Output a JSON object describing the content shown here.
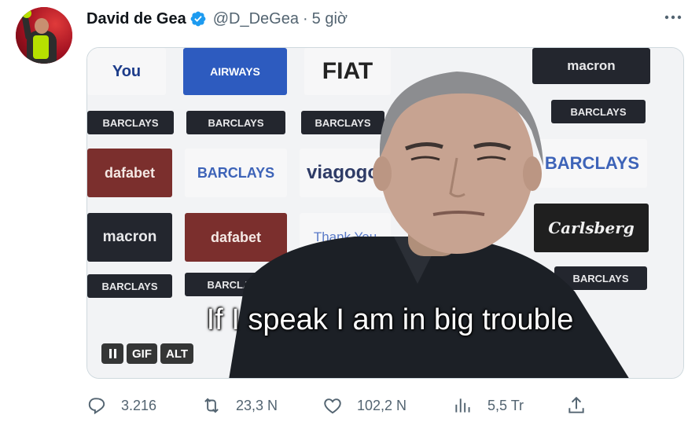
{
  "author": {
    "display_name": "David de Gea",
    "handle": "@D_DeGea",
    "separator": "·",
    "time": "5 giờ",
    "verified": true
  },
  "media": {
    "subtitle": "If I speak I am in big trouble",
    "badges": {
      "gif": "GIF",
      "alt": "ALT"
    },
    "sponsors": [
      "You",
      "AIRWAYS",
      "FIAT",
      "macron",
      "BARCLAYS",
      "BARCLAYS",
      "BARCLAYS",
      "BARCLAYS",
      "dafabet",
      "BARCLAYS",
      "viagogo",
      "BARCLAYS",
      "macron",
      "dafabet",
      "Thank You",
      "Carlsberg",
      "BARCLAYS",
      "BARCLAYS",
      "BARCLAYS"
    ]
  },
  "actions": {
    "replies": "3.216",
    "retweets": "23,3 N",
    "likes": "102,2 N",
    "views": "5,5 Tr"
  },
  "colors": {
    "verified_blue": "#1d9bf0",
    "muted_text": "#536471",
    "gif_yellow": "#b6e000"
  },
  "icons": {
    "more": "more-icon",
    "reply": "reply-icon",
    "retweet": "retweet-icon",
    "like": "heart-icon",
    "views": "views-icon",
    "share": "share-icon"
  }
}
